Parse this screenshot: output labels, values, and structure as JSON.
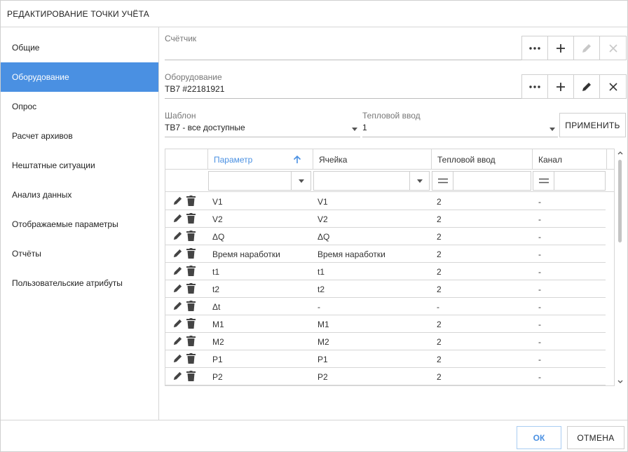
{
  "dialog": {
    "title": "РЕДАКТИРОВАНИЕ ТОЧКИ УЧЁТА"
  },
  "sidebar": {
    "items": [
      {
        "label": "Общие",
        "active": false
      },
      {
        "label": "Оборудование",
        "active": true
      },
      {
        "label": "Опрос",
        "active": false
      },
      {
        "label": "Расчет архивов",
        "active": false
      },
      {
        "label": "Нештатные ситуации",
        "active": false
      },
      {
        "label": "Анализ данных",
        "active": false
      },
      {
        "label": "Отображаемые параметры",
        "active": false
      },
      {
        "label": "Отчёты",
        "active": false
      },
      {
        "label": "Пользовательские атрибуты",
        "active": false
      }
    ]
  },
  "meter": {
    "label": "Счётчик",
    "value": ""
  },
  "equipment": {
    "label": "Оборудование",
    "value": "ТВ7 #22181921"
  },
  "template": {
    "label": "Шаблон",
    "value": "ТВ7 - все доступные"
  },
  "heat_input": {
    "label": "Тепловой ввод",
    "value": "1"
  },
  "apply_label": "ПРИМЕНИТЬ",
  "grid": {
    "columns": [
      "Параметр",
      "Ячейка",
      "Тепловой ввод",
      "Канал"
    ],
    "rows": [
      {
        "param": "V1",
        "cell": "V1",
        "input": "2",
        "channel": "-"
      },
      {
        "param": "V2",
        "cell": "V2",
        "input": "2",
        "channel": "-"
      },
      {
        "param": "ΔQ",
        "cell": "ΔQ",
        "input": "2",
        "channel": "-"
      },
      {
        "param": "Время наработки",
        "cell": "Время наработки",
        "input": "2",
        "channel": "-"
      },
      {
        "param": "t1",
        "cell": "t1",
        "input": "2",
        "channel": "-"
      },
      {
        "param": "t2",
        "cell": "t2",
        "input": "2",
        "channel": "-"
      },
      {
        "param": "Δt",
        "cell": "-",
        "input": "-",
        "channel": "-"
      },
      {
        "param": "M1",
        "cell": "M1",
        "input": "2",
        "channel": "-"
      },
      {
        "param": "M2",
        "cell": "M2",
        "input": "2",
        "channel": "-"
      },
      {
        "param": "P1",
        "cell": "P1",
        "input": "2",
        "channel": "-"
      },
      {
        "param": "P2",
        "cell": "P2",
        "input": "2",
        "channel": "-"
      }
    ]
  },
  "footer": {
    "ok_label": "ОК",
    "cancel_label": "ОТМЕНА"
  },
  "colors": {
    "accent": "#4a90e2",
    "icon": "#444444",
    "disabled_icon": "#c0c0c0"
  }
}
